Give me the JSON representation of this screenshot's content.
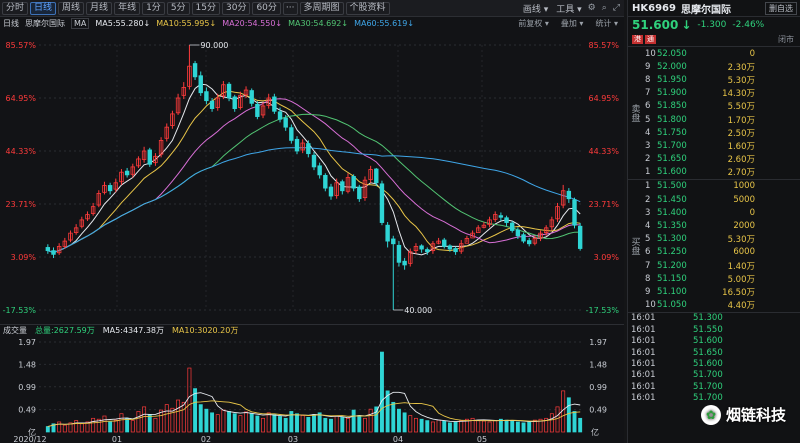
{
  "toolbar": {
    "tabs": [
      "分时",
      "日线",
      "周线",
      "月线",
      "年线",
      "1分",
      "5分",
      "15分",
      "30分",
      "60分"
    ],
    "active": 1,
    "more_icon": "ellipsis-icon",
    "multi": "多周期图",
    "f10": "个股资料",
    "draw": "画线",
    "tools": "工具",
    "right_icons": [
      "gear-icon",
      "search-icon",
      "fullscreen-icon"
    ]
  },
  "ma": {
    "label": "日线",
    "stock": "思摩尔国际",
    "sel": "MA",
    "items": [
      {
        "text": "MA5:55.280",
        "arrow": "↓",
        "color": "#e6e9ee"
      },
      {
        "text": "MA10:55.995",
        "arrow": "↓",
        "color": "#e8c548"
      },
      {
        "text": "MA20:54.550",
        "arrow": "↓",
        "color": "#d86fd6"
      },
      {
        "text": "MA30:54.692",
        "arrow": "↓",
        "color": "#52c473"
      },
      {
        "text": "MA60:55.619",
        "arrow": "↓",
        "color": "#3fa6e8"
      }
    ],
    "right": [
      "前复权",
      "叠加",
      "统计"
    ]
  },
  "volume": {
    "title": "成交量",
    "total": "总量:2627.59万",
    "ma5": "MA5:4347.38万",
    "ma10": "MA10:3020.20万",
    "ylabels": [
      "1.97",
      "1.48",
      "0.99",
      "0.49"
    ],
    "unit": "亿"
  },
  "xaxis": [
    "2020/12",
    "01",
    "02",
    "03",
    "04",
    "05"
  ],
  "chart_data": {
    "type": "candlestick",
    "ylabels_left": [
      "85.57%",
      "64.95%",
      "44.33%",
      "23.71%",
      "3.09%",
      "-17.53%"
    ],
    "ylabels_right": [
      "85.57%",
      "64.95%",
      "44.33%",
      "23.71%",
      "3.09%",
      "-17.53%"
    ],
    "annotations": [
      {
        "label": "90.000",
        "kind": "high"
      },
      {
        "label": "40.000",
        "kind": "low"
      }
    ],
    "close": [
      51.2,
      50.5,
      52.0,
      53.0,
      54.5,
      55.5,
      57.0,
      58.0,
      59.5,
      62.0,
      63.5,
      62.5,
      64.0,
      66.0,
      65.5,
      67.0,
      68.5,
      70.0,
      67.5,
      69.0,
      72.0,
      74.5,
      77.0,
      80.0,
      82.0,
      86.0,
      84.0,
      81.0,
      79.5,
      78.0,
      80.0,
      82.5,
      80.0,
      78.0,
      80.5,
      81.5,
      79.0,
      76.5,
      78.5,
      80.0,
      77.5,
      76.0,
      74.5,
      72.0,
      70.0,
      71.5,
      69.5,
      67.0,
      65.5,
      63.0,
      61.5,
      64.0,
      62.5,
      65.0,
      63.0,
      61.0,
      64.5,
      66.5,
      64.0,
      56.5,
      53.0,
      52.5,
      49.0,
      48.5,
      51.0,
      52.0,
      51.5,
      51.0,
      52.5,
      53.0,
      52.0,
      51.5,
      51.0,
      52.5,
      53.5,
      54.5,
      55.5,
      56.0,
      57.0,
      58.0,
      57.5,
      56.5,
      55.0,
      54.0,
      53.0,
      52.5,
      53.5,
      54.5,
      55.5,
      57.0,
      59.5,
      62.5,
      61.0,
      56.0,
      51.6
    ],
    "open": [
      51.8,
      51.2,
      50.8,
      52.0,
      53.2,
      54.6,
      55.8,
      57.2,
      58.2,
      59.8,
      62.2,
      63.5,
      62.8,
      64.2,
      66.2,
      65.6,
      67.2,
      68.4,
      70.2,
      67.8,
      69.4,
      72.4,
      74.8,
      77.2,
      80.5,
      82.2,
      86.5,
      84.2,
      81.2,
      79.4,
      78.2,
      80.4,
      82.6,
      80.2,
      78.2,
      80.6,
      81.4,
      78.8,
      76.8,
      78.6,
      80.2,
      77.4,
      76.2,
      74.4,
      72.2,
      70.2,
      71.4,
      69.2,
      67.2,
      65.4,
      63.2,
      61.6,
      64.2,
      62.4,
      65.2,
      63.2,
      61.2,
      64.6,
      66.6,
      63.8,
      56.0,
      53.4,
      52.2,
      49.2,
      48.8,
      51.2,
      52.1,
      51.4,
      51.2,
      52.6,
      53.2,
      52.1,
      51.6,
      51.1,
      52.6,
      53.6,
      54.6,
      55.6,
      56.1,
      57.1,
      57.8,
      57.4,
      56.4,
      55.1,
      54.2,
      53.1,
      52.6,
      53.6,
      54.6,
      55.7,
      57.2,
      59.8,
      62.4,
      60.8,
      55.8
    ],
    "high": [
      52.4,
      51.8,
      52.6,
      53.6,
      55.0,
      56.2,
      57.6,
      58.6,
      60.2,
      62.6,
      64.2,
      64.0,
      64.8,
      66.6,
      66.8,
      67.6,
      69.0,
      70.8,
      70.6,
      69.6,
      72.6,
      75.2,
      77.6,
      80.8,
      83.0,
      90.0,
      87.0,
      85.0,
      82.0,
      80.0,
      80.8,
      83.2,
      83.0,
      80.6,
      81.2,
      82.2,
      81.8,
      79.4,
      79.2,
      80.8,
      80.8,
      78.2,
      76.8,
      75.0,
      72.8,
      72.2,
      72.0,
      69.8,
      67.8,
      65.8,
      63.8,
      64.8,
      64.6,
      65.8,
      65.6,
      63.6,
      65.2,
      67.2,
      66.8,
      64.4,
      56.6,
      54.0,
      53.0,
      49.8,
      51.6,
      52.6,
      52.4,
      51.8,
      53.0,
      53.6,
      53.6,
      52.4,
      52.0,
      53.2,
      54.0,
      55.0,
      56.0,
      56.6,
      57.6,
      58.6,
      58.4,
      57.8,
      56.8,
      55.6,
      54.6,
      53.6,
      54.0,
      55.0,
      56.0,
      57.6,
      60.2,
      63.6,
      63.0,
      61.2,
      56.4
    ],
    "low": [
      50.6,
      49.8,
      50.4,
      51.6,
      52.8,
      54.2,
      55.4,
      56.8,
      57.8,
      59.4,
      61.8,
      61.8,
      62.2,
      63.6,
      65.0,
      65.0,
      66.8,
      67.8,
      67.0,
      67.2,
      68.8,
      71.8,
      74.2,
      76.8,
      79.8,
      81.6,
      83.4,
      80.4,
      78.8,
      77.4,
      77.6,
      79.8,
      79.4,
      77.4,
      77.8,
      80.0,
      78.4,
      76.0,
      76.2,
      78.0,
      77.0,
      75.4,
      73.8,
      71.4,
      69.4,
      69.6,
      68.8,
      66.4,
      64.8,
      62.4,
      60.8,
      61.0,
      61.8,
      62.0,
      62.4,
      60.4,
      60.6,
      64.0,
      63.4,
      56.0,
      51.8,
      40.0,
      48.2,
      47.6,
      48.2,
      50.6,
      50.8,
      50.4,
      50.6,
      52.4,
      51.6,
      51.0,
      50.4,
      50.6,
      52.8,
      53.8,
      54.8,
      55.4,
      55.6,
      56.6,
      56.8,
      55.8,
      54.6,
      53.4,
      52.6,
      52.0,
      52.2,
      53.0,
      54.0,
      55.0,
      56.6,
      59.2,
      60.2,
      55.4,
      51.2
    ],
    "volume": [
      0.12,
      0.18,
      0.22,
      0.15,
      0.2,
      0.25,
      0.18,
      0.22,
      0.3,
      0.28,
      0.35,
      0.22,
      0.26,
      0.4,
      0.3,
      0.25,
      0.45,
      0.55,
      0.38,
      0.3,
      0.48,
      0.6,
      0.52,
      0.7,
      0.65,
      1.4,
      0.95,
      0.6,
      0.5,
      0.42,
      0.38,
      0.48,
      0.45,
      0.4,
      0.36,
      0.44,
      0.4,
      0.35,
      0.3,
      0.42,
      0.38,
      0.34,
      0.3,
      0.45,
      0.4,
      0.36,
      0.32,
      0.38,
      0.42,
      0.3,
      0.28,
      0.35,
      0.32,
      0.3,
      0.48,
      0.36,
      0.3,
      0.5,
      0.55,
      1.75,
      0.9,
      0.65,
      0.5,
      0.42,
      0.36,
      0.3,
      0.28,
      0.25,
      0.22,
      0.26,
      0.24,
      0.2,
      0.22,
      0.25,
      0.28,
      0.3,
      0.26,
      0.24,
      0.22,
      0.25,
      0.28,
      0.26,
      0.24,
      0.22,
      0.2,
      0.22,
      0.26,
      0.28,
      0.3,
      0.4,
      0.55,
      0.9,
      0.75,
      0.45,
      0.3
    ]
  },
  "quote": {
    "code": "HK6969",
    "name": "思摩尔国际",
    "btn": "删自选",
    "price": "51.600",
    "arrow": "↓",
    "change": "-1.300",
    "change_pct": "-2.46%",
    "tags": [
      "港",
      "通"
    ],
    "status": "闭市",
    "sell_label": "卖盘",
    "buy_label": "买盘",
    "asks": [
      {
        "lv": "10",
        "price": "52.050",
        "vol": "0"
      },
      {
        "lv": "9",
        "price": "52.000",
        "vol": "2.30万"
      },
      {
        "lv": "8",
        "price": "51.950",
        "vol": "5.30万"
      },
      {
        "lv": "7",
        "price": "51.900",
        "vol": "14.30万"
      },
      {
        "lv": "6",
        "price": "51.850",
        "vol": "5.50万"
      },
      {
        "lv": "5",
        "price": "51.800",
        "vol": "1.70万"
      },
      {
        "lv": "4",
        "price": "51.750",
        "vol": "2.50万"
      },
      {
        "lv": "3",
        "price": "51.700",
        "vol": "1.60万"
      },
      {
        "lv": "2",
        "price": "51.650",
        "vol": "2.60万"
      },
      {
        "lv": "1",
        "price": "51.600",
        "vol": "2.70万"
      }
    ],
    "bids": [
      {
        "lv": "1",
        "price": "51.500",
        "vol": "1000"
      },
      {
        "lv": "2",
        "price": "51.450",
        "vol": "5000"
      },
      {
        "lv": "3",
        "price": "51.400",
        "vol": "0"
      },
      {
        "lv": "4",
        "price": "51.350",
        "vol": "2000"
      },
      {
        "lv": "5",
        "price": "51.300",
        "vol": "5.30万"
      },
      {
        "lv": "6",
        "price": "51.250",
        "vol": "6000"
      },
      {
        "lv": "7",
        "price": "51.200",
        "vol": "1.40万"
      },
      {
        "lv": "8",
        "price": "51.150",
        "vol": "5.00万"
      },
      {
        "lv": "9",
        "price": "51.100",
        "vol": "16.50万"
      },
      {
        "lv": "10",
        "price": "51.050",
        "vol": "4.40万"
      }
    ],
    "ticks": [
      {
        "t": "16:01",
        "p": "51.300"
      },
      {
        "t": "16:01",
        "p": "51.550"
      },
      {
        "t": "16:01",
        "p": "51.600"
      },
      {
        "t": "16:01",
        "p": "51.650"
      },
      {
        "t": "16:01",
        "p": "51.600"
      },
      {
        "t": "16:01",
        "p": "51.700"
      },
      {
        "t": "16:01",
        "p": "51.700"
      },
      {
        "t": "16:01",
        "p": "51.700"
      }
    ]
  },
  "watermark": "烟链科技",
  "colors": {
    "up": "#ff3b3b",
    "down": "#2fd5d5",
    "green": "#2fd17c",
    "ma5": "#e6e9ee",
    "ma10": "#e8c548",
    "ma20": "#d86fd6",
    "ma30": "#52c473",
    "ma60": "#3fa6e8"
  }
}
